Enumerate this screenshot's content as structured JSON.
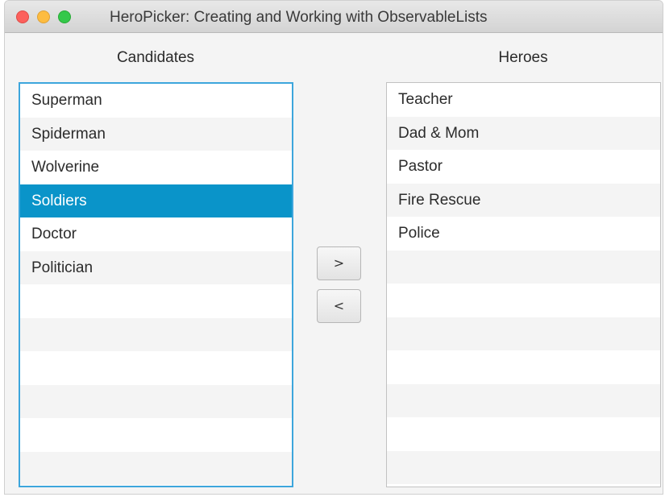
{
  "window": {
    "title": "HeroPicker: Creating and Working with ObservableLists"
  },
  "candidates": {
    "label": "Candidates",
    "items": [
      "Superman",
      "Spiderman",
      "Wolverine",
      "Soldiers",
      "Doctor",
      "Politician",
      "",
      "",
      "",
      "",
      "",
      ""
    ],
    "selected": "Soldiers"
  },
  "heroes": {
    "label": "Heroes",
    "items": [
      "Teacher",
      "Dad & Mom",
      "Pastor",
      "Fire Rescue",
      "Police",
      "",
      "",
      "",
      "",
      "",
      "",
      ""
    ]
  },
  "buttons": {
    "add_label": ">",
    "remove_label": "<"
  },
  "colors": {
    "selection": "#0a94c9",
    "focus_border": "#3da6dc",
    "close": "#fc605c",
    "minimize": "#fdbc40",
    "zoom": "#34c84a"
  }
}
